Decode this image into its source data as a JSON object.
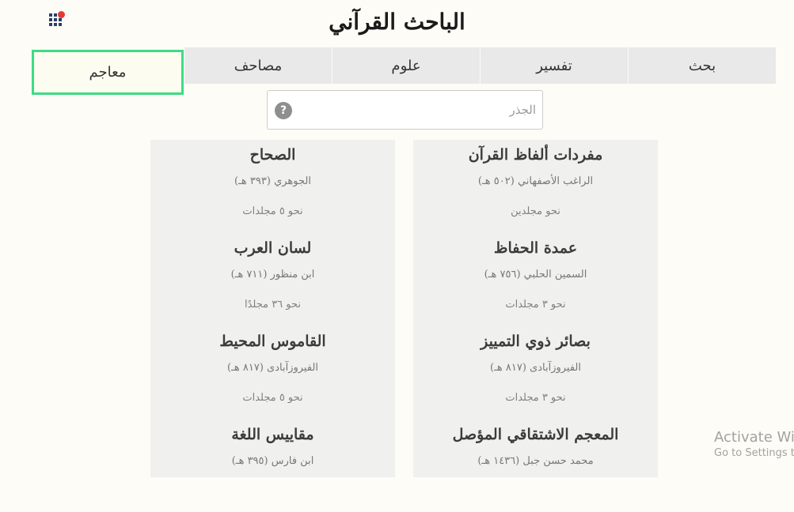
{
  "app": {
    "title": "الباحث القرآني"
  },
  "tabs": [
    {
      "label": "بحث",
      "active": false
    },
    {
      "label": "تفسير",
      "active": false
    },
    {
      "label": "علوم",
      "active": false
    },
    {
      "label": "مصاحف",
      "active": false
    },
    {
      "label": "معاجم",
      "active": true
    }
  ],
  "search": {
    "placeholder": "الجذر",
    "value": "",
    "help_label": "?"
  },
  "dictionaries": {
    "right_column": [
      {
        "name": "مفردات ألفاظ القرآن",
        "author": "الراغب الأصفهاني (٥٠٢ هـ)",
        "volumes": "نحو مجلدين"
      },
      {
        "name": "عمدة الحفاظ",
        "author": "السمين الحلبي (٧٥٦ هـ)",
        "volumes": "نحو ٣ مجلدات"
      },
      {
        "name": "بصائر ذوي التمييز",
        "author": "الفيروزآبادى (٨١٧ هـ)",
        "volumes": "نحو ٣ مجلدات"
      },
      {
        "name": "المعجم الاشتقاقي المؤصل",
        "author": "محمد حسن جبل (١٤٣٦ هـ)",
        "volumes": ""
      }
    ],
    "left_column": [
      {
        "name": "الصحاح",
        "author": "الجوهري (٣٩٣ هـ)",
        "volumes": "نحو ٥ مجلدات"
      },
      {
        "name": "لسان العرب",
        "author": "ابن منظور (٧١١ هـ)",
        "volumes": "نحو ٣٦ مجلدًا"
      },
      {
        "name": "القاموس المحيط",
        "author": "الفيروزآبادى (٨١٧ هـ)",
        "volumes": "نحو ٥ مجلدات"
      },
      {
        "name": "مقاييس اللغة",
        "author": "ابن فارس (٣٩٥ هـ)",
        "volumes": ""
      }
    ]
  },
  "watermark": {
    "line1": "Activate Wi",
    "line2": "Go to Settings t"
  },
  "colors": {
    "active_tab_border": "#3ddc84",
    "notification_dot": "#e53935",
    "apps_icon": "#2b3e6b"
  },
  "icons": {
    "apps": "grid-apps-icon",
    "notification": "notification-dot-icon",
    "help": "question-circle-icon"
  }
}
